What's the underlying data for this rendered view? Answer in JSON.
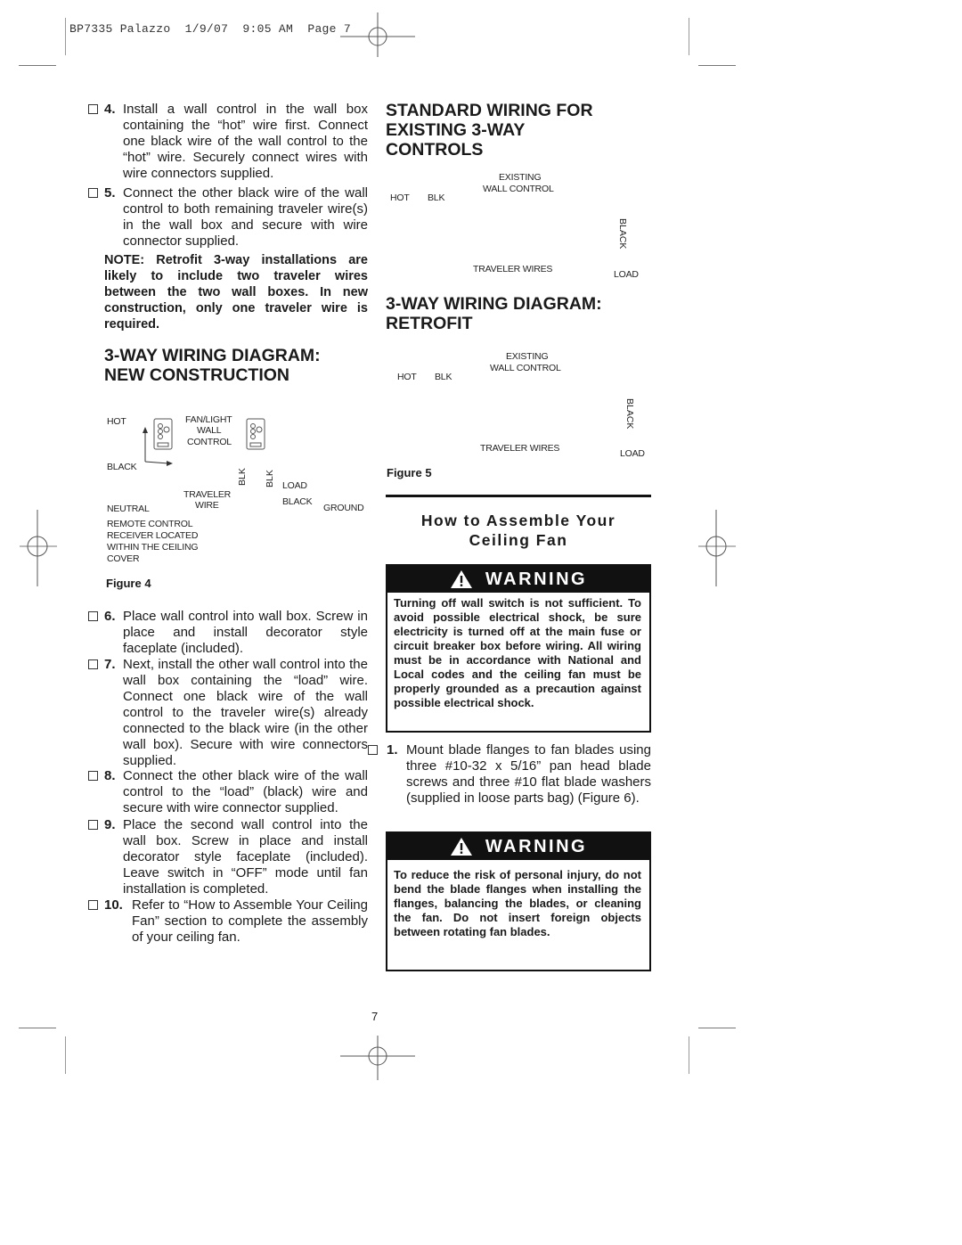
{
  "print_slug": "BP7335 Palazzo  1/9/07  9:05 AM  Page 7",
  "left_column": {
    "steps_top": [
      {
        "number": "4.",
        "text": "Install a wall control in the wall box containing the “hot” wire first. Connect one black wire of the wall  control to the “hot” wire. Securely connect wires with wire connectors supplied."
      },
      {
        "number": "5.",
        "text": "Connect the other black wire of the wall control to both remaining traveler wire(s) in the wall box and secure with wire connector supplied."
      }
    ],
    "note": "NOTE: Retrofit 3-way installations are likely to include two traveler wires between the two wall boxes. In new construction, only one traveler wire is required.",
    "figure4": {
      "heading_line1": "3-WAY WIRING DIAGRAM:",
      "heading_line2": "NEW CONSTRUCTION",
      "labels": {
        "hot": "HOT",
        "fan_light_1": "FAN/LIGHT",
        "fan_light_2": "WALL",
        "fan_light_3": "CONTROL",
        "black": "BLACK",
        "blk1": "BLK",
        "blk2": "BLK",
        "load": "LOAD",
        "traveler_1": "TRAVELER",
        "traveler_2": "WIRE",
        "black2": "BLACK",
        "neutral": "NEUTRAL",
        "ground": "GROUND",
        "receiver_1": "REMOTE CONTROL",
        "receiver_2": "RECEIVER LOCATED",
        "receiver_3": "WITHIN THE CEILING",
        "receiver_4": "COVER"
      },
      "caption": "Figure 4"
    },
    "steps_bottom": [
      {
        "number": "6.",
        "text": "Place wall control into wall box. Screw in place and install decorator style faceplate (included)."
      },
      {
        "number": "7.",
        "text": "Next, install the other wall control into the wall box containing the “load” wire. Connect one black wire of the wall control to the traveler wire(s) already connected to the black wire (in the other wall box). Secure with wire connectors supplied."
      },
      {
        "number": "8.",
        "text": "Connect the other black wire of the wall control to the “load” (black) wire and secure with wire connector supplied."
      },
      {
        "number": "9.",
        "text": "Place the second wall control into the wall box. Screw in place and install decorator style faceplate (included). Leave switch in “OFF” mode until fan installation is completed."
      },
      {
        "number": "10.",
        "text": "Refer to “How to Assemble Your Ceiling Fan” section to complete the assembly of your ceiling fan."
      }
    ]
  },
  "right_column": {
    "standard": {
      "heading_line1": "STANDARD WIRING FOR",
      "heading_line2": "EXISTING 3-WAY",
      "heading_line3": "CONTROLS",
      "labels": {
        "existing": "EXISTING",
        "wall_control": "WALL  CONTROL",
        "hot": "HOT",
        "blk": "BLK",
        "black": "BLACK",
        "traveler_wires": "TRAVELER WIRES",
        "load": "LOAD"
      }
    },
    "retrofit": {
      "heading_line1": "3-WAY WIRING DIAGRAM:",
      "heading_line2": "RETROFIT",
      "labels": {
        "existing": "EXISTING",
        "wall_control": "WALL  CONTROL",
        "hot": "HOT",
        "blk": "BLK",
        "black": "BLACK",
        "traveler_wires": "TRAVELER WIRES",
        "load": "LOAD"
      },
      "caption": "Figure 5"
    },
    "assemble_title_line1": "How to Assemble Your",
    "assemble_title_line2": "Ceiling Fan",
    "warning1": {
      "label": "WARNING",
      "icon": "warning-triangle-icon",
      "text": "Turning off wall switch is not sufficient. To avoid possible electrical shock, be sure electricity is turned off at the main fuse or circuit breaker box before wiring. All wiring must be in accordance with National and Local codes and the ceiling fan must be properly grounded as a precaution against possible electrical shock."
    },
    "step1": {
      "number": "1.",
      "text": "Mount blade flanges to fan blades using three #10-32 x 5/16” pan head blade screws and three #10 flat blade washers (supplied in loose parts bag) (Figure 6)."
    },
    "warning2": {
      "label": "WARNING",
      "icon": "warning-triangle-icon",
      "text": "To reduce the risk of personal injury, do not bend the blade flanges when installing the flanges, balancing the blades, or cleaning the fan. Do not insert foreign objects between rotating fan blades."
    }
  },
  "page_number": "7"
}
